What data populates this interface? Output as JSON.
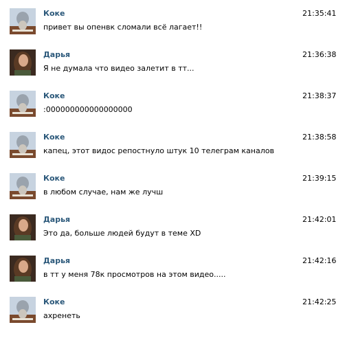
{
  "messages": [
    {
      "author": "Коке",
      "time": "21:35:41",
      "text": "привет вы опенвк сломали всё лагает!!"
    },
    {
      "author": "Дарья",
      "time": "21:36:38",
      "text": "Я не думала что видео залетит в тт..."
    },
    {
      "author": "Коке",
      "time": "21:38:37",
      "text": ":000000000000000000"
    },
    {
      "author": "Коке",
      "time": "21:38:58",
      "text": "капец, этот видос репостнуло штук 10 телеграм каналов"
    },
    {
      "author": "Коке",
      "time": "21:39:15",
      "text": "в любом случае, нам же лучш"
    },
    {
      "author": "Дарья",
      "time": "21:42:01",
      "text": "Это да, больше людей будут в теме XD"
    },
    {
      "author": "Дарья",
      "time": "21:42:16",
      "text": "в тт у меня 78к просмотров на этом видео....."
    },
    {
      "author": "Коке",
      "time": "21:42:25",
      "text": "ахренеть"
    }
  ],
  "colors": {
    "author_link": "#2b587a",
    "text": "#000000",
    "background": "#ffffff"
  },
  "icons": {
    "koke_avatar": "user-avatar-icon",
    "darya_avatar": "user-avatar-icon"
  }
}
